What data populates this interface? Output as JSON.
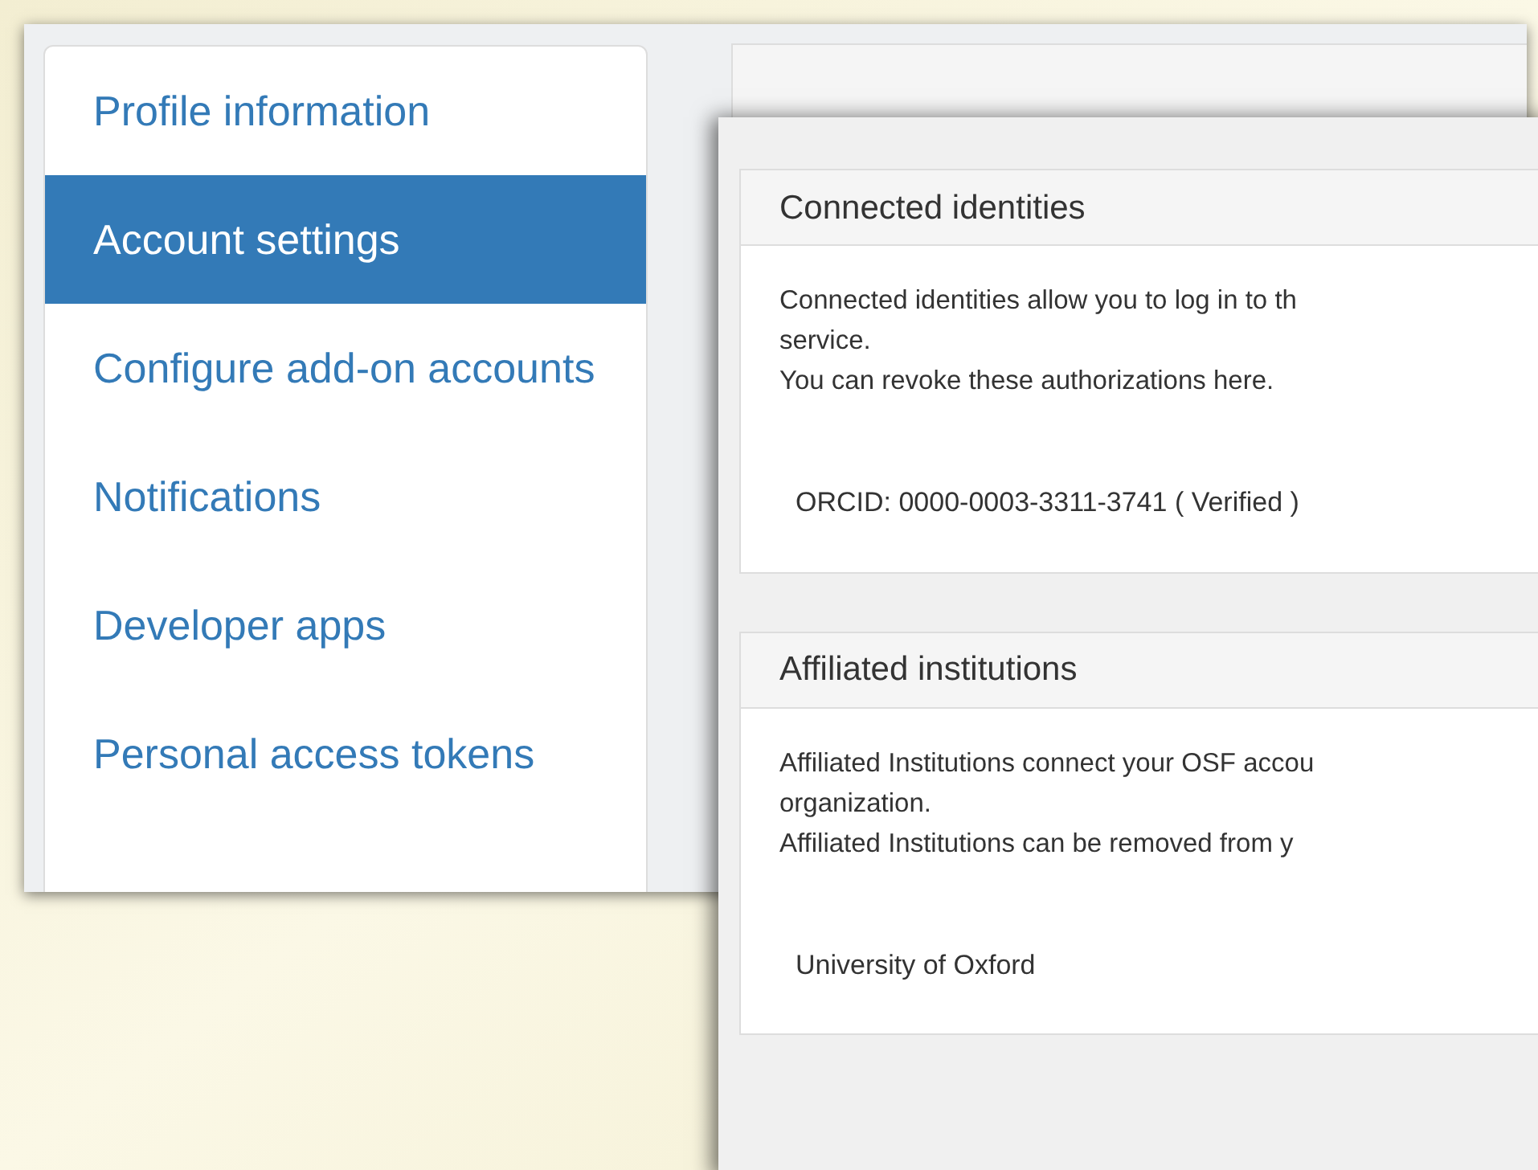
{
  "sidebar": {
    "items": [
      {
        "label": "Profile information",
        "selected": false
      },
      {
        "label": "Account settings",
        "selected": true
      },
      {
        "label": "Configure add-on accounts",
        "selected": false
      },
      {
        "label": "Notifications",
        "selected": false
      },
      {
        "label": "Developer apps",
        "selected": false
      },
      {
        "label": "Personal access tokens",
        "selected": false
      }
    ]
  },
  "panels": [
    {
      "title": "Connected identities",
      "description": [
        "Connected identities allow you to log in to th",
        "service.",
        "You can revoke these authorizations here."
      ],
      "entries": [
        "ORCID: 0000-0003-3311-3741 ( Verified )"
      ]
    },
    {
      "title": "Affiliated institutions",
      "description": [
        "Affiliated Institutions connect your OSF accou",
        "organization.",
        "Affiliated Institutions can be removed from y"
      ],
      "entries": [
        "University of Oxford"
      ]
    }
  ]
}
